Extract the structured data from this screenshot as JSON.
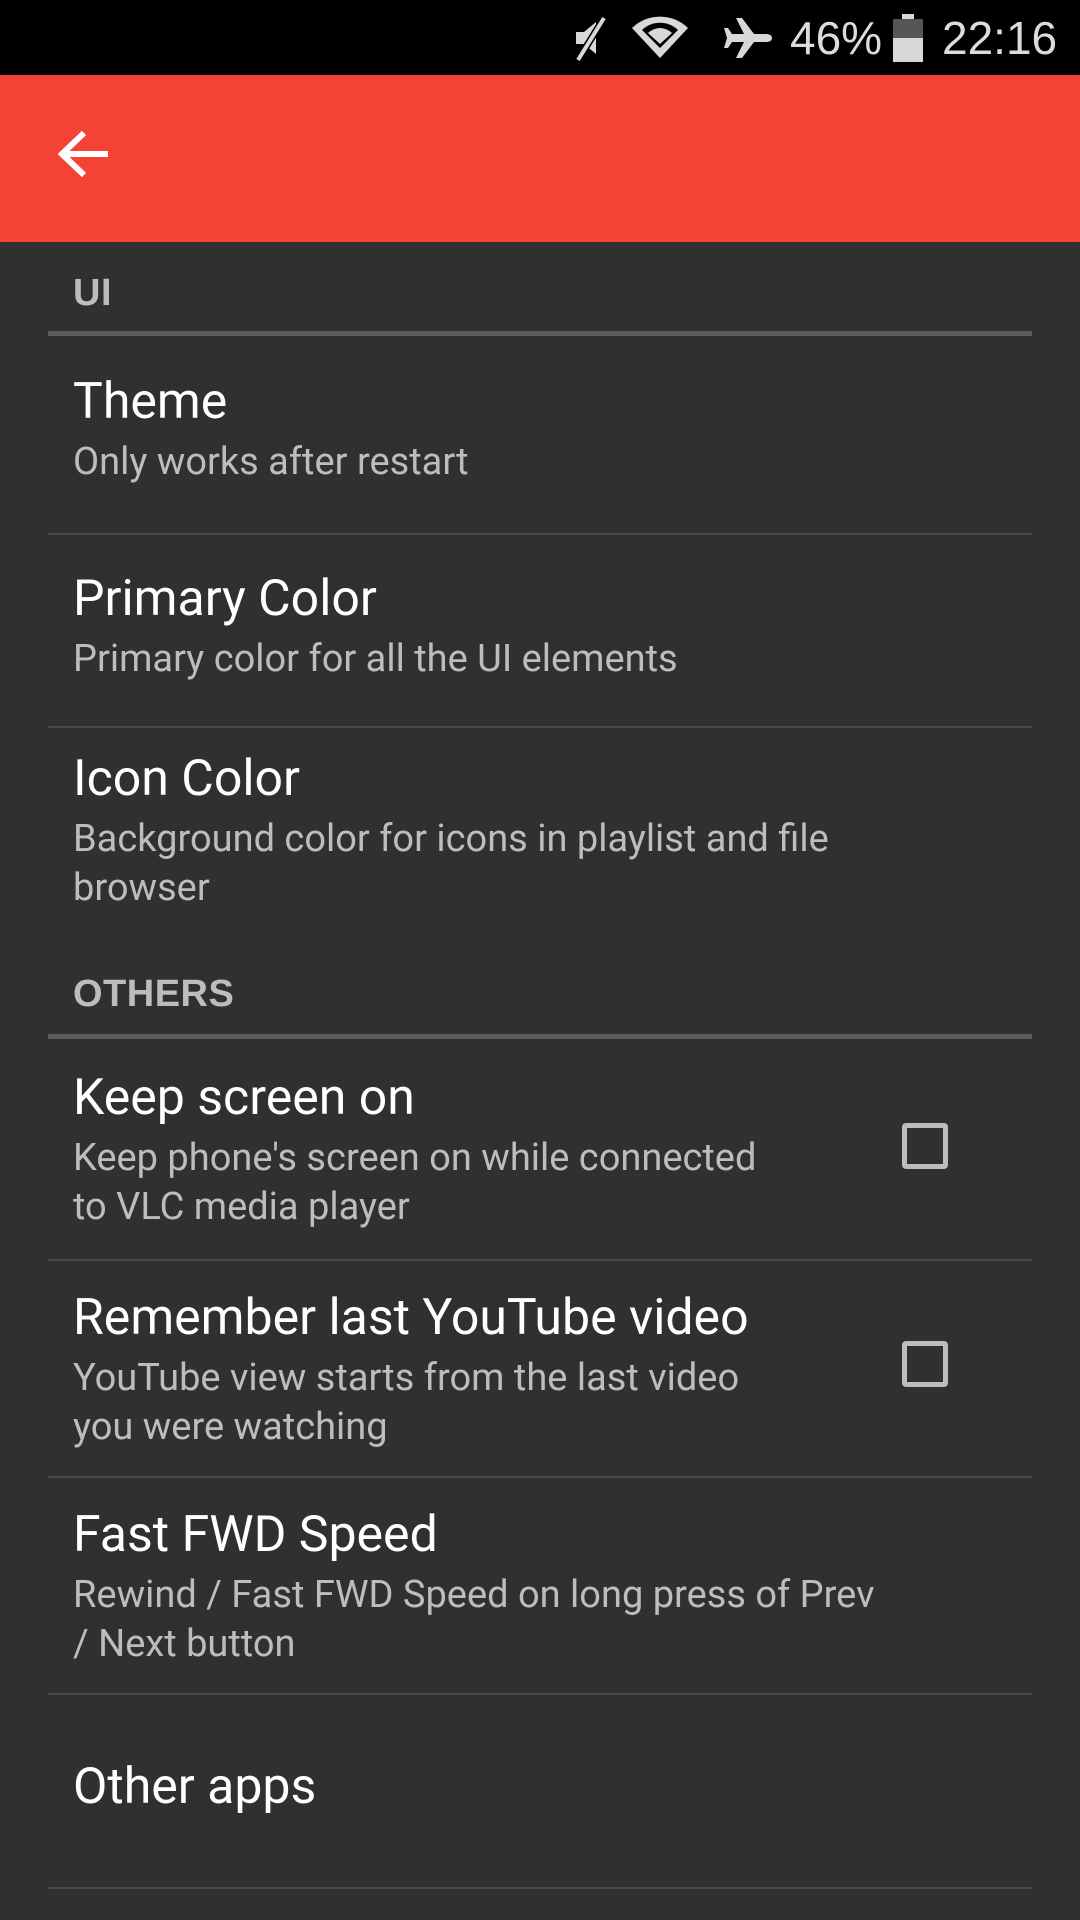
{
  "status_bar": {
    "battery_percent": "46%",
    "time": "22:16",
    "icons": [
      "mute-icon",
      "wifi-icon",
      "airplane-mode-icon",
      "battery-icon"
    ]
  },
  "app_bar": {
    "background_color": "#f44336",
    "back_icon": "arrow-back-icon"
  },
  "sections": {
    "ui": {
      "header": "UI",
      "items": {
        "theme": {
          "title": "Theme",
          "summary": "Only works after restart"
        },
        "primary_color": {
          "title": "Primary Color",
          "summary": "Primary color for all the UI elements"
        },
        "icon_color": {
          "title": "Icon Color",
          "summary_line1": "Background color for icons in playlist and file",
          "summary_line2": "browser"
        }
      }
    },
    "others": {
      "header": "OTHERS",
      "items": {
        "keep_screen_on": {
          "title": "Keep screen on",
          "summary_line1": "Keep phone's screen on while connected",
          "summary_line2": "to VLC media player",
          "checked": false
        },
        "remember_youtube": {
          "title": "Remember last YouTube video",
          "summary_line1": "YouTube view starts from the last video",
          "summary_line2": "you were watching",
          "checked": false
        },
        "fast_fwd_speed": {
          "title": "Fast FWD Speed",
          "summary_line1": "Rewind / Fast FWD Speed on long press of Prev",
          "summary_line2": "/ Next button"
        },
        "other_apps": {
          "title": "Other apps"
        }
      }
    }
  }
}
